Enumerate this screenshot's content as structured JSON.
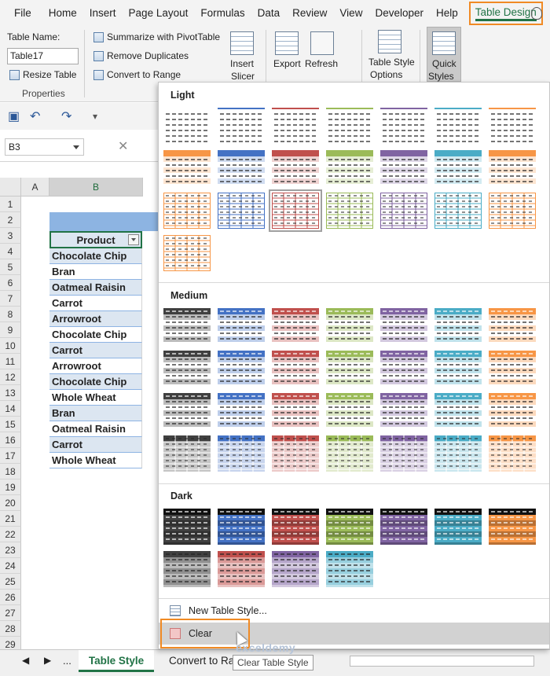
{
  "ribbon_tabs": [
    "File",
    "Home",
    "Insert",
    "Page Layout",
    "Formulas",
    "Data",
    "Review",
    "View",
    "Developer",
    "Help",
    "Table Design"
  ],
  "active_tab": "Table Design",
  "properties": {
    "table_name_label": "Table Name:",
    "table_name_value": "Table17",
    "resize_label": "Resize Table",
    "group_label": "Properties"
  },
  "tools": {
    "summarize": "Summarize with PivotTable",
    "remove_duplicates": "Remove Duplicates",
    "convert_range": "Convert to Range",
    "insert_slicer_1": "Insert",
    "insert_slicer_2": "Slicer",
    "export_label": "Export",
    "refresh_label": "Refresh",
    "style_options_1": "Table Style",
    "style_options_2": "Options",
    "quick_styles_1": "Quick",
    "quick_styles_2": "Styles"
  },
  "name_box": "B3",
  "columns": [
    "A",
    "B"
  ],
  "row_numbers": [
    "1",
    "2",
    "3",
    "4",
    "5",
    "6",
    "7",
    "8",
    "9",
    "10",
    "11",
    "12",
    "13",
    "14",
    "15",
    "16",
    "17",
    "18",
    "19",
    "20",
    "21",
    "22",
    "23",
    "24",
    "25",
    "26",
    "27",
    "28",
    "29"
  ],
  "table": {
    "header": "Product",
    "rows": [
      "Chocolate Chip",
      "Bran",
      "Oatmeal Raisin",
      "Carrot",
      "Arrowroot",
      "Chocolate Chip",
      "Carrot",
      "Arrowroot",
      "Chocolate Chip",
      "Whole Wheat",
      "Bran",
      "Oatmeal Raisin",
      "Carrot",
      "Whole Wheat"
    ]
  },
  "gallery": {
    "sections": [
      "Light",
      "Medium",
      "Dark"
    ],
    "new_style": "New Table Style...",
    "clear": "Clear",
    "tooltip": "Clear Table Style",
    "style_colors": [
      "#404040",
      "#4472c4",
      "#c0504d",
      "#9bbb59",
      "#8064a2",
      "#4bacc6",
      "#f79646"
    ]
  },
  "sheet_tabs": [
    "Table Style",
    "Convert to Ra"
  ],
  "sheet_nav": "...",
  "watermark": "exceldemy"
}
